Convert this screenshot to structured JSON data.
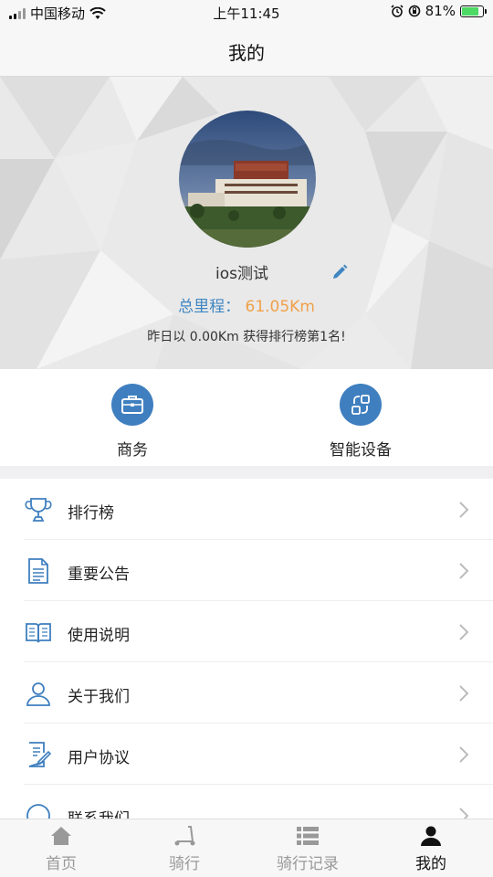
{
  "status_bar": {
    "carrier": "中国移动",
    "time": "上午11:45",
    "battery_percent": "81%",
    "battery_level": 0.81,
    "icons": [
      "signal-icon",
      "wifi-icon",
      "alarm-icon",
      "orientation-lock-icon",
      "battery-charging-icon"
    ]
  },
  "nav": {
    "title": "我的"
  },
  "profile": {
    "username": "ios测试",
    "mileage_label": "总里程：",
    "mileage_value": "61.05Km",
    "rank_text": "昨日以 0.00Km 获得排行榜第1名!",
    "avatar": "potala-palace-photo"
  },
  "quick_actions": [
    {
      "label": "商务",
      "icon": "briefcase-icon"
    },
    {
      "label": "智能设备",
      "icon": "device-swap-icon"
    }
  ],
  "menu": [
    {
      "label": "排行榜",
      "icon": "trophy-icon"
    },
    {
      "label": "重要公告",
      "icon": "document-icon"
    },
    {
      "label": "使用说明",
      "icon": "book-icon"
    },
    {
      "label": "关于我们",
      "icon": "person-icon"
    },
    {
      "label": "用户协议",
      "icon": "agreement-icon"
    },
    {
      "label": "联系我们",
      "icon": "contact-icon"
    }
  ],
  "tabs": [
    {
      "label": "首页",
      "icon": "home-icon",
      "active": false
    },
    {
      "label": "骑行",
      "icon": "scooter-icon",
      "active": false
    },
    {
      "label": "骑行记录",
      "icon": "list-icon",
      "active": false
    },
    {
      "label": "我的",
      "icon": "user-icon",
      "active": true
    }
  ],
  "colors": {
    "accent_blue": "#3f7fbf",
    "mileage_label": "#3f86c2",
    "mileage_value": "#f0a04a",
    "tab_active": "#111111",
    "tab_inactive": "#999999",
    "battery_green": "#4cd964"
  }
}
